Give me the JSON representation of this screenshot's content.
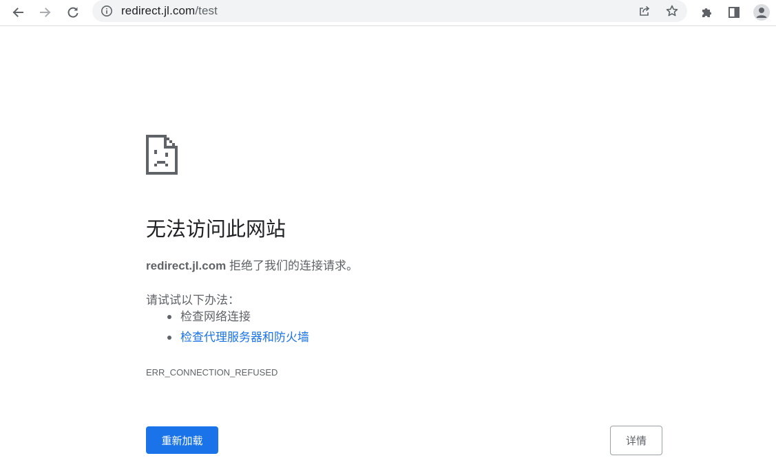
{
  "browser": {
    "url_host": "redirect.jl.com",
    "url_path": "/test",
    "icons": {
      "back": "arrow-left-icon",
      "forward": "arrow-right-icon",
      "reload": "reload-icon",
      "site_info": "info-icon",
      "share": "share-icon",
      "bookmark": "star-icon",
      "extensions": "puzzle-icon",
      "side_panel": "side-panel-icon",
      "profile": "profile-avatar-icon"
    }
  },
  "error_page": {
    "title": "无法访问此网站",
    "host": "redirect.jl.com",
    "description": " 拒绝了我们的连接请求。",
    "try_label": "请试试以下办法：",
    "suggestions": [
      {
        "text": "检查网络连接",
        "is_link": false
      },
      {
        "text": "检查代理服务器和防火墙",
        "is_link": true
      }
    ],
    "error_code": "ERR_CONNECTION_REFUSED",
    "reload_label": "重新加载",
    "details_label": "详情"
  },
  "colors": {
    "accent": "#1a73e8",
    "text_primary": "#202124",
    "text_secondary": "#5f6368",
    "omnibox_bg": "#f1f3f4"
  }
}
